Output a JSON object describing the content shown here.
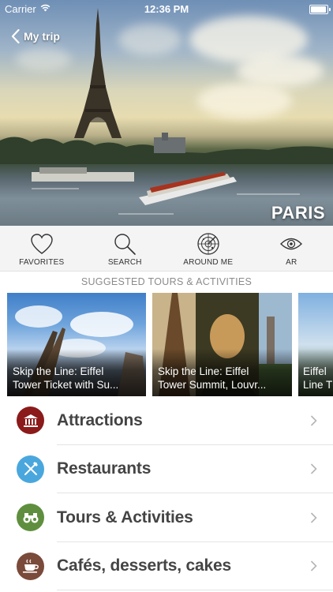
{
  "status_bar": {
    "carrier": "Carrier",
    "time": "12:36 PM"
  },
  "header": {
    "back_label": "My trip",
    "city": "PARIS"
  },
  "toolbar": [
    {
      "label": "FAVORITES",
      "icon": "heart-icon"
    },
    {
      "label": "SEARCH",
      "icon": "search-icon"
    },
    {
      "label": "AROUND ME",
      "icon": "radar-icon"
    },
    {
      "label": "AR",
      "icon": "eye-icon"
    }
  ],
  "suggested": {
    "header": "SUGGESTED TOURS & ACTIVITIES",
    "cards": [
      {
        "title_line1": "Skip the Line: Eiffel",
        "title_line2": "Tower Ticket with Su..."
      },
      {
        "title_line1": "Skip the Line: Eiffel",
        "title_line2": "Tower Summit, Louvr..."
      },
      {
        "title_line1": "Eiffel",
        "title_line2": "Line T"
      }
    ]
  },
  "categories": [
    {
      "label": "Attractions",
      "icon": "museum-icon",
      "color": "#8b1a1a"
    },
    {
      "label": "Restaurants",
      "icon": "fork-knife-icon",
      "color": "#4aa7dd"
    },
    {
      "label": "Tours & Activities",
      "icon": "binoculars-icon",
      "color": "#5f8f3e"
    },
    {
      "label": "Cafés, desserts, cakes",
      "icon": "coffee-cup-icon",
      "color": "#7a4a3a"
    }
  ]
}
